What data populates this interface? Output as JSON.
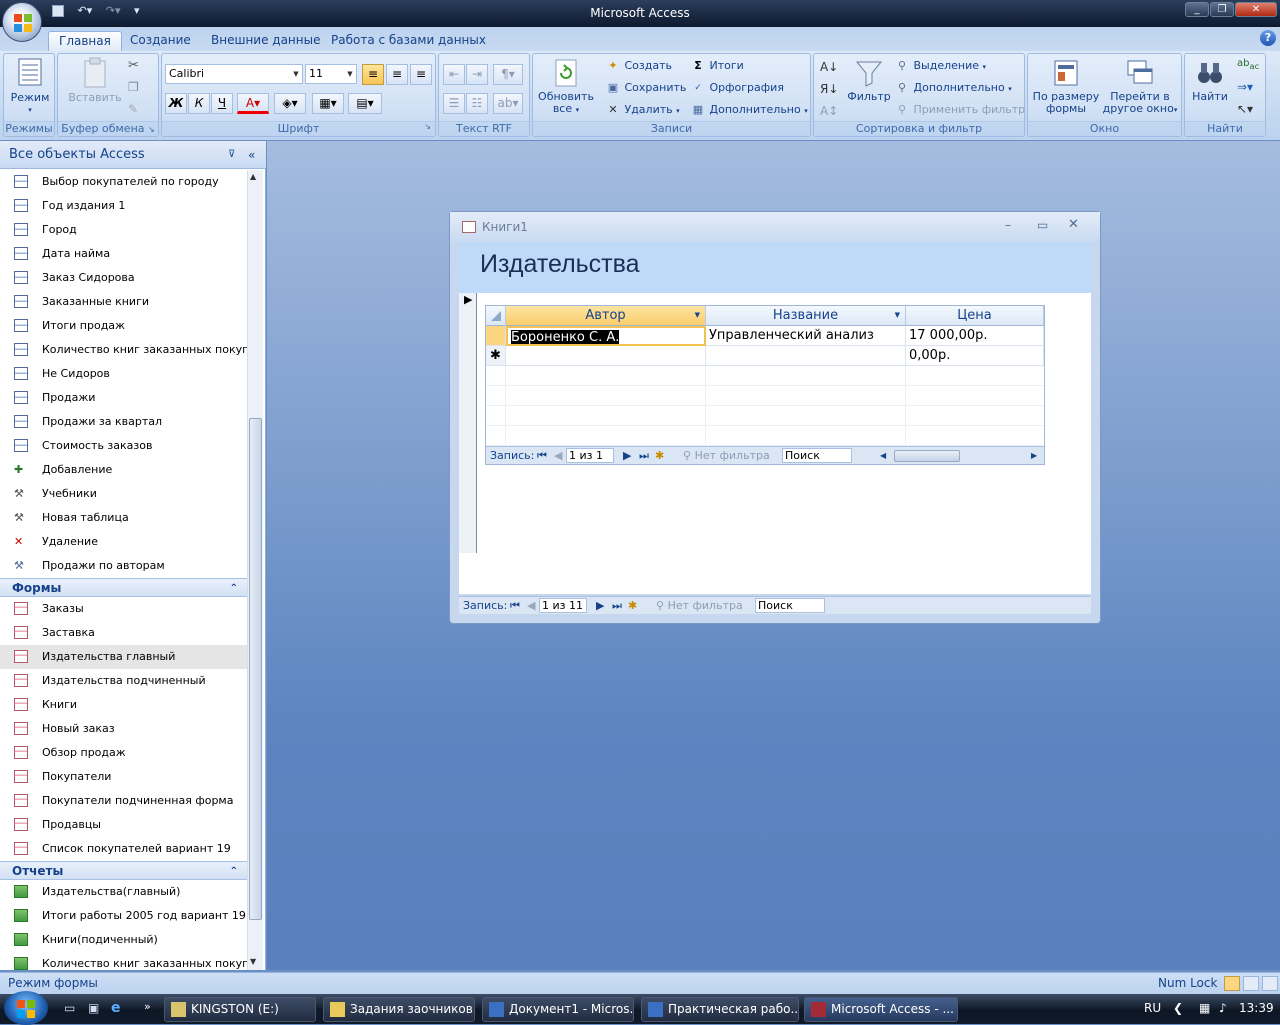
{
  "app": {
    "title": "Microsoft Access"
  },
  "ribbon": {
    "tabs": [
      "Главная",
      "Создание",
      "Внешние данные",
      "Работа с базами данных"
    ],
    "groups": {
      "modes": "Режимы",
      "clipboard": "Буфер обмена",
      "font": "Шрифт",
      "rtf": "Текст RTF",
      "records": "Записи",
      "sortfilter": "Сортировка и фильтр",
      "window": "Окно",
      "find": "Найти"
    },
    "buttons": {
      "mode": "Режим",
      "paste": "Вставить",
      "refresh_1": "Обновить",
      "refresh_2": "все",
      "create": "Создать",
      "save": "Сохранить",
      "delete": "Удалить",
      "totals": "Итоги",
      "spelling": "Орфография",
      "more": "Дополнительно",
      "filter": "Фильтр",
      "selection": "Выделение",
      "advanced": "Дополнительно",
      "apply_filter": "Применить фильтр",
      "fit_form_1": "По размеру",
      "fit_form_2": "формы",
      "switch_1": "Перейти в",
      "switch_2": "другое окно",
      "find": "Найти"
    },
    "font": {
      "name": "Calibri",
      "size": "11"
    }
  },
  "nav": {
    "header": "Все объекты Access",
    "queries": [
      "Выбор покупателей по городу",
      "Год издания 1",
      "Город",
      "Дата найма",
      "Заказ Сидорова",
      "Заказанные книги",
      "Итоги продаж",
      "Количество книг заказанных покуп...",
      "Не Сидоров",
      "Продажи",
      "Продажи за квартал",
      "Стоимость заказов",
      "Добавление",
      "Учебники",
      "Новая таблица",
      "Удаление",
      "Продажи по авторам"
    ],
    "forms_group": "Формы",
    "forms": [
      "Заказы",
      "Заставка",
      "Издательства главный",
      "Издательства подчиненный",
      "Книги",
      "Новый заказ",
      "Обзор продаж",
      "Покупатели",
      "Покупатели подчиненная форма",
      "Продавцы",
      "Список покупателей вариант 19"
    ],
    "reports_group": "Отчеты",
    "reports": [
      "Издательства(главный)",
      "Итоги работы 2005 год вариант 19",
      "Книги(подиченный)",
      "Количество книг заказанных покуп..."
    ]
  },
  "form": {
    "window_title": "Книги1",
    "header": "Издательства",
    "sub": {
      "columns": [
        "Автор",
        "Название",
        "Цена"
      ],
      "rows": [
        [
          "Бороненко С. А.",
          "Управленческий анализ",
          "17 000,00р."
        ],
        [
          "",
          "",
          "0,00р."
        ]
      ],
      "nav": {
        "label": "Запись:",
        "position": "1 из 1",
        "nofilter": "Нет фильтра",
        "search": "Поиск"
      }
    },
    "nav": {
      "label": "Запись:",
      "position": "1 из 11",
      "nofilter": "Нет фильтра",
      "search": "Поиск"
    }
  },
  "status": {
    "left": "Режим формы",
    "numlock": "Num Lock"
  },
  "taskbar": {
    "items": [
      "KINGSTON (E:)",
      "Задания заочников...",
      "Документ1 - Micros...",
      "Практическая рабо...",
      "Microsoft Access - ..."
    ],
    "lang": "RU",
    "time": "13:39"
  }
}
